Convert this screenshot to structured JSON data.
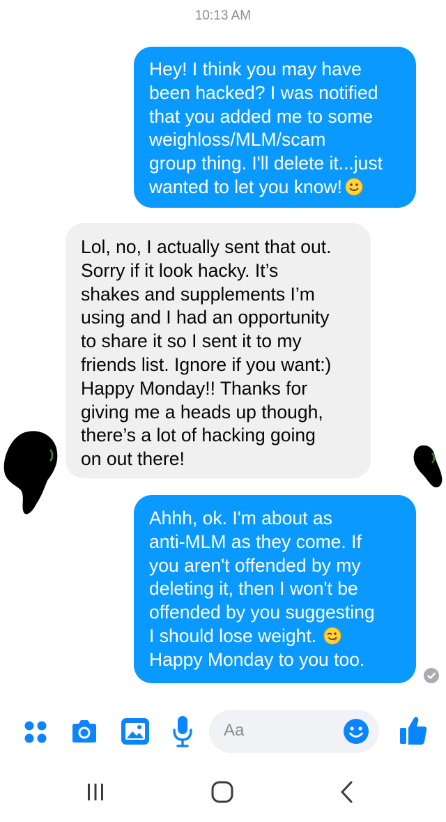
{
  "timestamp": "10:13 AM",
  "messages": [
    {
      "direction": "outgoing",
      "lines": [
        "Hey! I think you may have",
        "been hacked? I was notified",
        "that you added me to some",
        "weighloss/MLM/scam",
        "group thing. I'll delete it...just",
        "wanted to let you know!"
      ],
      "trailing_emoji": "slightly-smiling-emoji"
    },
    {
      "direction": "incoming",
      "lines": [
        "Lol, no, I actually sent that out.",
        "Sorry if it look hacky. It’s",
        "shakes and supplements I’m",
        "using and I had an opportunity",
        "to share it so I sent it to my",
        "friends list. Ignore if you want:)",
        "Happy Monday!! Thanks for",
        "giving me a heads up though,",
        "there’s a lot of hacking going",
        "on out there!"
      ]
    },
    {
      "direction": "outgoing",
      "lines": [
        "Ahhh, ok. I'm about as",
        "anti-MLM as they come. If",
        "you aren't offended by my",
        "deleting it, then I won't be",
        "offended by you suggesting",
        "I should lose weight.",
        "Happy Monday to you too."
      ],
      "inline_emoji": "winking-emoji"
    }
  ],
  "composer": {
    "placeholder": "Aa",
    "icons": [
      "more-options-icon",
      "camera-icon",
      "gallery-icon",
      "microphone-icon",
      "emoji-icon",
      "thumbs-up-icon"
    ]
  },
  "nav_bar": {
    "icons": [
      "recent-apps-icon",
      "home-icon",
      "back-icon"
    ]
  },
  "colors": {
    "outgoing_bubble": "#0a99ff",
    "incoming_bubble": "#f0f0f0",
    "accent": "#0a84ff",
    "timestamp": "#8a8d91"
  }
}
